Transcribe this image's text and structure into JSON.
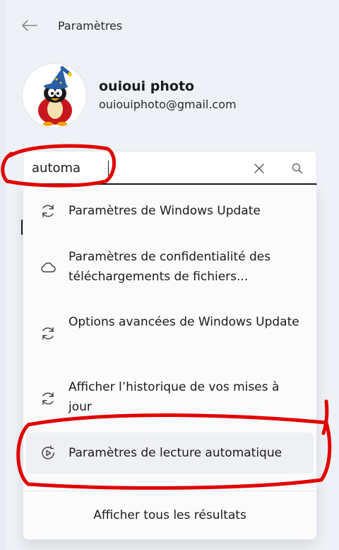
{
  "window": {
    "title": "Paramètres"
  },
  "account": {
    "name": "ouioui photo",
    "email": "ouiouiphoto@gmail.com"
  },
  "search": {
    "value": "automa"
  },
  "results": [
    {
      "label": "Paramètres de Windows Update",
      "icon": "sync-icon"
    },
    {
      "label": "Paramètres de confidentialité des téléchargements de fichiers...",
      "icon": "cloud-icon"
    },
    {
      "label": "Options avancées de Windows Update",
      "icon": "sync-icon"
    },
    {
      "label": "Afficher l’historique de vos mises à jour",
      "icon": "sync-icon"
    },
    {
      "label": "Paramètres de lecture automatique",
      "icon": "autoplay-icon",
      "selected": true
    }
  ],
  "show_all": "Afficher tous les résultats",
  "annotations": {
    "stroke_color": "#e00000"
  }
}
